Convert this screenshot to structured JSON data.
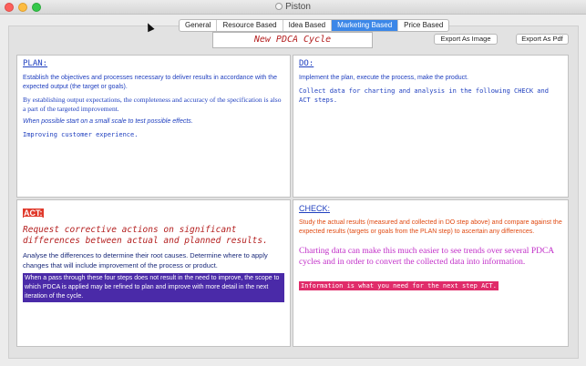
{
  "window": {
    "title": "Piston"
  },
  "tabs": [
    {
      "label": "General",
      "active": false
    },
    {
      "label": "Resource Based",
      "active": false
    },
    {
      "label": "Idea Based",
      "active": false
    },
    {
      "label": "Marketing Based",
      "active": true
    },
    {
      "label": "Price Based",
      "active": false
    }
  ],
  "cycle_title": "New PDCA Cycle",
  "buttons": {
    "export_image": "Export As Image",
    "export_pdf": "Export As Pdf"
  },
  "plan": {
    "heading": "PLAN:",
    "p1": "Establish the objectives and processes necessary to deliver results in accordance with the expected output (the target or goals).",
    "p2": "By establishing output expectations, the completeness and accuracy of the specification is also a part of the targeted improvement.",
    "p3": "When possible start on a small scale to test possible effects.",
    "p4": "Improving customer experience."
  },
  "do": {
    "heading": "DO:",
    "p1": "Implement the plan, execute the process, make the product.",
    "p2": "Collect data for charting and analysis in the following CHECK and ACT steps."
  },
  "act": {
    "heading": "ACT:",
    "p1": "Request corrective actions on significant differences between actual and planned results.",
    "p2": "Analyse the differences to determine their root causes. Determine where to apply changes that will include improvement of the process or product.",
    "p3": "When a pass through these four steps does not result in the need to improve, the scope to which PDCA is applied may be refined to plan and improve with more detail in the next iteration of the cycle."
  },
  "check": {
    "heading": "CHECK:",
    "p1": "Study the actual results (measured and collected in DO step above) and compare against the expected results (targets or goals from the PLAN step) to ascertain any differences.",
    "p2": "Charting data can make this much easier to see trends over several PDCA cycles and in order to convert the collected data into information.",
    "p3": "Information is what you need for the next step ACT."
  },
  "colors": {
    "tab_active": "#3b87e8",
    "heading_blue": "#1f3fbf",
    "act_red": "#e0392b",
    "dark_red": "#b41f1f",
    "purple_highlight": "#4a2aa8",
    "orange_text": "#e04a12",
    "magenta_text": "#c12ec8",
    "pink_highlight": "#e02c6a"
  }
}
